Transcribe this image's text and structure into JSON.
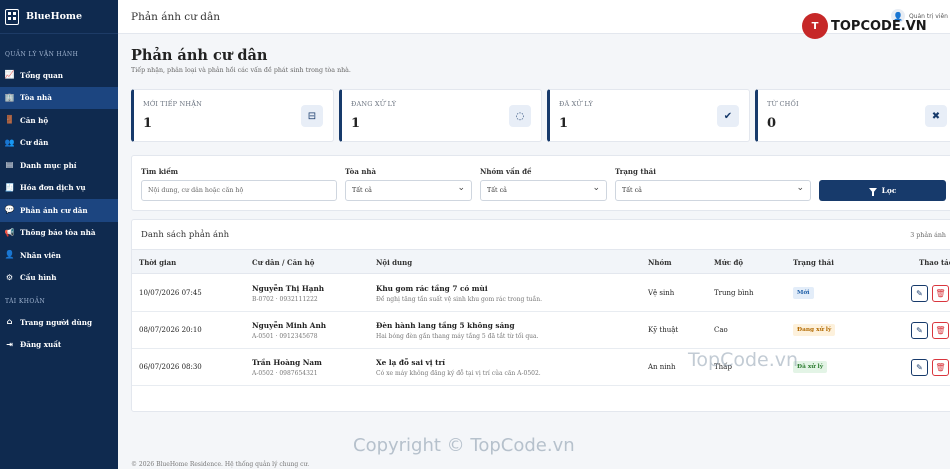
{
  "brand": {
    "name": "BlueHome"
  },
  "sidebar": {
    "section_main": "QUẢN LÝ VẬN HÀNH",
    "items": [
      {
        "label": "Tổng quan",
        "icon": "chart-line-icon"
      },
      {
        "label": "Tòa nhà",
        "icon": "building-icon"
      },
      {
        "label": "Căn hộ",
        "icon": "door-icon"
      },
      {
        "label": "Cư dân",
        "icon": "users-icon"
      },
      {
        "label": "Danh mục phí",
        "icon": "file-icon"
      },
      {
        "label": "Hóa đơn dịch vụ",
        "icon": "receipt-icon"
      },
      {
        "label": "Phản ánh cư dân",
        "icon": "comments-icon"
      },
      {
        "label": "Thông báo tòa nhà",
        "icon": "megaphone-icon"
      },
      {
        "label": "Nhân viên",
        "icon": "user-tie-icon"
      },
      {
        "label": "Cấu hình",
        "icon": "gear-icon"
      }
    ],
    "section_account": "TÀI KHOẢN",
    "account_items": [
      {
        "label": "Trang người dùng",
        "icon": "home-icon"
      },
      {
        "label": "Đăng xuất",
        "icon": "logout-icon"
      }
    ]
  },
  "topbar": {
    "title": "Phản ánh cư dân",
    "user": "Quản trị viên"
  },
  "page": {
    "title": "Phản ánh cư dân",
    "subtitle": "Tiếp nhận, phân loại và phản hồi các vấn đề phát sinh trong tòa nhà."
  },
  "stats": [
    {
      "label": "MỚI TIẾP NHẬN",
      "value": "1",
      "icon": "inbox-icon"
    },
    {
      "label": "ĐANG XỬ LÝ",
      "value": "1",
      "icon": "spinner-icon"
    },
    {
      "label": "ĐÃ XỬ LÝ",
      "value": "1",
      "icon": "check-circle-icon"
    },
    {
      "label": "TỪ CHỐI",
      "value": "0",
      "icon": "x-circle-icon"
    }
  ],
  "filter": {
    "search_label": "Tìm kiếm",
    "search_placeholder": "Nội dung, cư dân hoặc căn hộ",
    "building_label": "Tòa nhà",
    "building_value": "Tất cả",
    "group_label": "Nhóm vấn đề",
    "group_value": "Tất cả",
    "status_label": "Trạng thái",
    "status_value": "Tất cả",
    "button": "Lọc"
  },
  "table": {
    "title": "Danh sách phản ánh",
    "count": "3 phản ánh",
    "columns": [
      "Thời gian",
      "Cư dân / Căn hộ",
      "Nội dung",
      "Nhóm",
      "Mức độ",
      "Trạng thái",
      "Thao tác"
    ],
    "rows": [
      {
        "time": "10/07/2026 07:45",
        "resident": "Nguyễn Thị Hạnh",
        "apartment": "B-0702 · 0932111222",
        "title": "Khu gom rác tầng 7 có mùi",
        "desc": "Đề nghị tăng tần suất vệ sinh khu gom rác trong tuần.",
        "group": "Vệ sinh",
        "level": "Trung bình",
        "status": "Mới",
        "status_color": "#1f5fa8",
        "status_bg": "#e3edf9"
      },
      {
        "time": "08/07/2026 20:10",
        "resident": "Nguyễn Minh Anh",
        "apartment": "A-0501 · 0912345678",
        "title": "Đèn hành lang tầng 5 không sáng",
        "desc": "Hai bóng đèn gần thang máy tầng 5 đã tắt từ tối qua.",
        "group": "Kỹ thuật",
        "level": "Cao",
        "status": "Đang xử lý",
        "status_color": "#b26a00",
        "status_bg": "#fdf1dc"
      },
      {
        "time": "06/07/2026 08:30",
        "resident": "Trần Hoàng Nam",
        "apartment": "A-0502 · 0987654321",
        "title": "Xe lạ đỗ sai vị trí",
        "desc": "Có xe máy không đăng ký đỗ tại vị trí của căn A-0502.",
        "group": "An ninh",
        "level": "Thấp",
        "status": "Đã xử lý",
        "status_color": "#2e7d32",
        "status_bg": "#e3f4e6"
      }
    ]
  },
  "footer": "© 2026 BlueHome Residence. Hệ thống quản lý chung cư.",
  "watermarks": {
    "logo_mark": "T",
    "logo_text": "TOPCODE.VN",
    "center": "TopCode.vn",
    "bottom": "Copyright © TopCode.vn"
  }
}
